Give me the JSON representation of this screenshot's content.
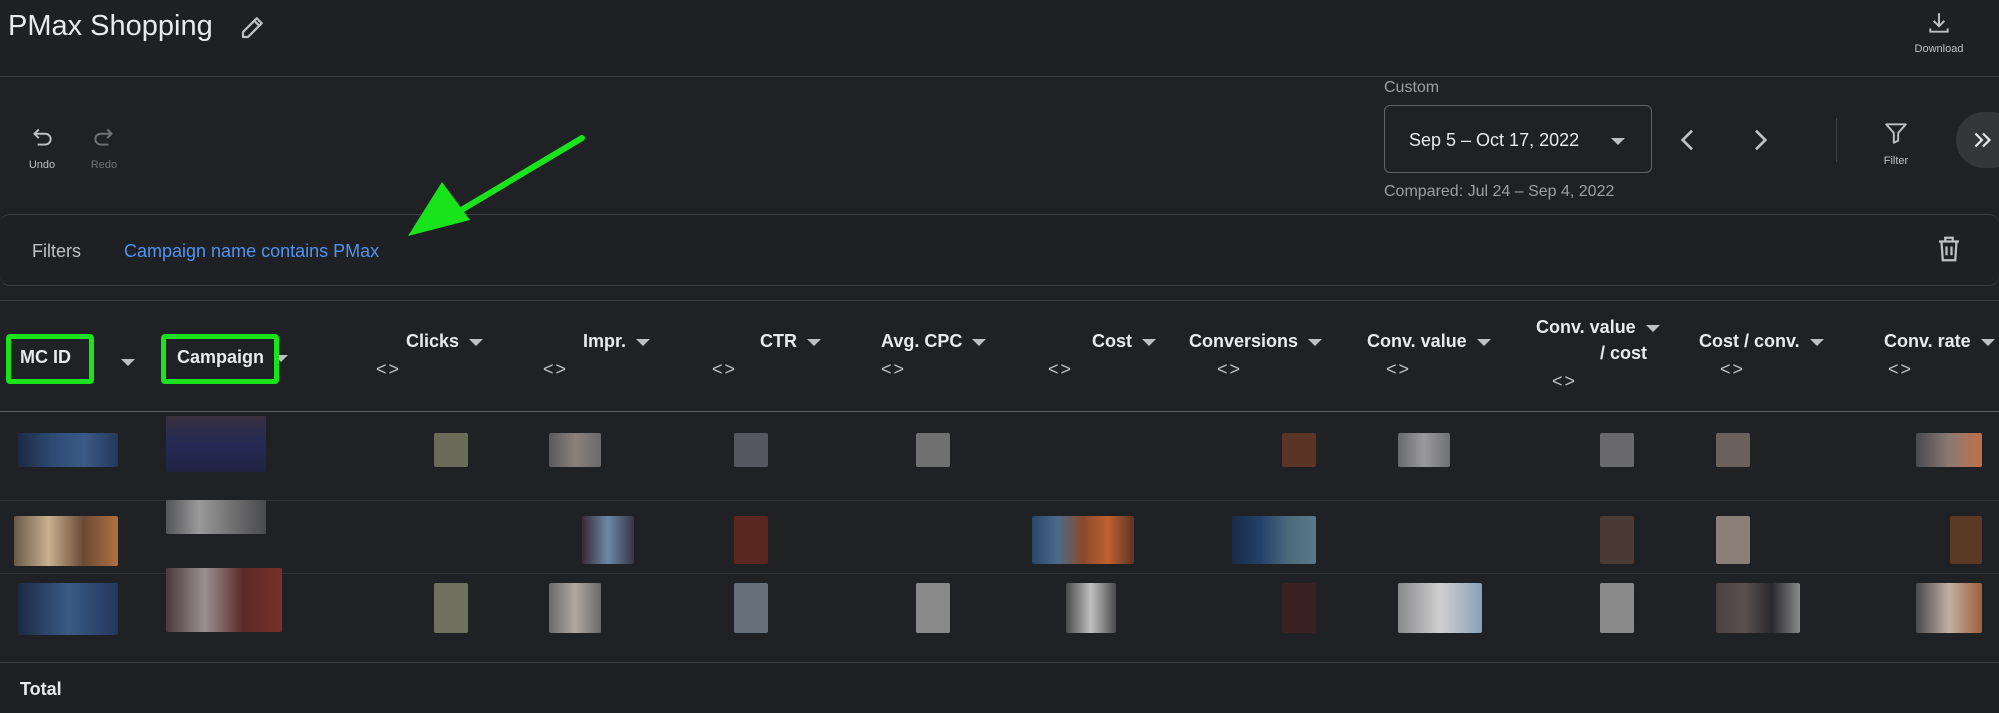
{
  "report": {
    "title": "PMax Shopping"
  },
  "toolbar": {
    "download_label": "Download",
    "undo_label": "Undo",
    "redo_label": "Redo",
    "filter_label": "Filter"
  },
  "date_range": {
    "label": "Custom",
    "value": "Sep 5 – Oct 17, 2022",
    "compared": "Compared: Jul 24 – Sep 4, 2022"
  },
  "filters": {
    "label": "Filters",
    "active": "Campaign name contains PMax"
  },
  "table": {
    "columns": [
      {
        "label": "MC ID"
      },
      {
        "label": "Campaign"
      },
      {
        "label": "Clicks"
      },
      {
        "label": "Impr."
      },
      {
        "label": "CTR"
      },
      {
        "label": "Avg. CPC"
      },
      {
        "label": "Cost"
      },
      {
        "label": "Conversions"
      },
      {
        "label": "Conv. value"
      },
      {
        "label": "Conv. value",
        "label2": "/ cost"
      },
      {
        "label": "Cost / conv."
      },
      {
        "label": "Conv. rate"
      }
    ],
    "compare_glyph": "<>",
    "total_label": "Total"
  },
  "colors": {
    "highlight": "#19e31b",
    "arrow": "#19e31b",
    "filter_link": "#4f94f0"
  }
}
